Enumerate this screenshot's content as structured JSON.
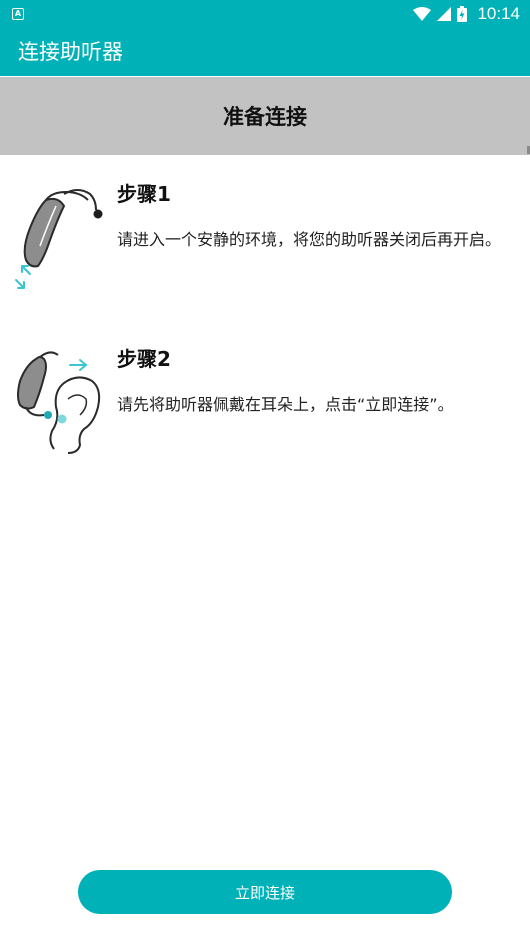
{
  "status_bar": {
    "notification_icon": "a-box-icon",
    "time": "10:14"
  },
  "app_bar": {
    "title": "连接助听器"
  },
  "header": {
    "title": "准备连接"
  },
  "steps": [
    {
      "title": "步骤1",
      "description": "请进入一个安静的环境，将您的助听器关闭后再开启。",
      "icon": "hearing-aid-restart-icon"
    },
    {
      "title": "步骤2",
      "description": "请先将助听器佩戴在耳朵上，点击“立即连接”。",
      "icon": "hearing-aid-ear-icon"
    }
  ],
  "connect_button": {
    "label": "立即连接"
  },
  "colors": {
    "primary": "#00b2b7",
    "header_band": "#c2c2c2",
    "accent_cyan": "#39c6d0"
  }
}
